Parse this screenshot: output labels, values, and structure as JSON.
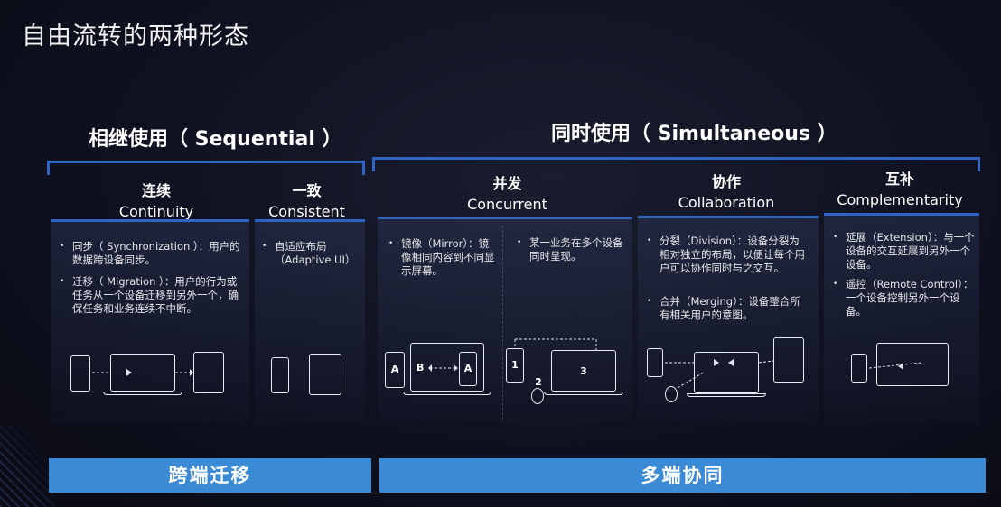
{
  "slide_title": "自由流转的两种形态",
  "sequential": {
    "title": "相继使用（ Sequential ）",
    "columns": [
      {
        "zh": "连续",
        "en": "Continuity",
        "bullets": [
          "同步（ Synchronization ）：用户的数据跨设备同步。",
          "迁移（ Migration ）：用户的行为或任务从一个设备迁移到另外一个，确保任务和业务连续不中断。"
        ]
      },
      {
        "zh": "一致",
        "en": "Consistent",
        "bullets": [
          "自适应布局（Adaptive UI）"
        ]
      }
    ],
    "footer": "跨端迁移"
  },
  "simultaneous": {
    "title": "同时使用（ Simultaneous ）",
    "columns": [
      {
        "zh": "并发",
        "en": "Concurrent",
        "bullets": [
          "镜像（Mirror）：镜像相同内容到不同显示屏幕。",
          "某一业务在多个设备同时呈现。"
        ]
      },
      {
        "zh": "协作",
        "en": "Collaboration",
        "bullets": [
          "分裂（Division）：设备分裂为相对独立的布局，以便让每个用户可以协作同时与之交互。",
          "合并（Merging）：设备整合所有相关用户的意图。"
        ]
      },
      {
        "zh": "互补",
        "en": "Complementarity",
        "bullets": [
          "延展（Extension）：与一个设备的交互延展到另外一个设备。",
          "遥控（Remote Control）：一个设备控制另外一个设备。"
        ]
      }
    ],
    "footer": "多端协同"
  },
  "device_labels": {
    "a1": "A",
    "b": "B",
    "a2": "A",
    "n1": "1",
    "n2": "2",
    "n3": "3"
  },
  "colors": {
    "accent_blue": "#2f64c6",
    "footer_blue": "#3a8ad6",
    "background": "#0f1120"
  }
}
